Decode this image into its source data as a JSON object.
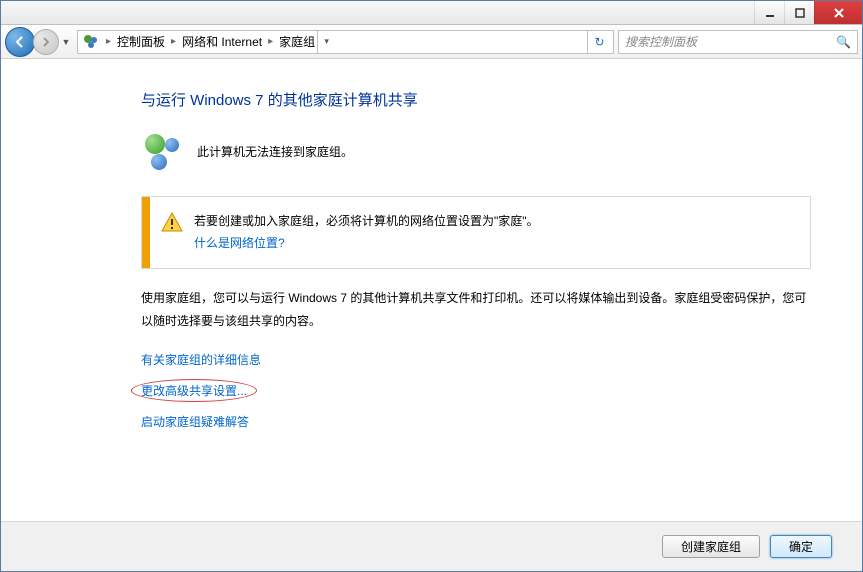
{
  "breadcrumb": {
    "items": [
      "控制面板",
      "网络和 Internet",
      "家庭组"
    ]
  },
  "search": {
    "placeholder": "搜索控制面板"
  },
  "main": {
    "heading": "与运行 Windows 7 的其他家庭计算机共享",
    "status": "此计算机无法连接到家庭组。",
    "warning": {
      "text": "若要创建或加入家庭组，必须将计算机的网络位置设置为\"家庭\"。",
      "link": "什么是网络位置?"
    },
    "description": "使用家庭组，您可以与运行 Windows 7 的其他计算机共享文件和打印机。还可以将媒体输出到设备。家庭组受密码保护，您可以随时选择要与该组共享的内容。",
    "links": {
      "details": "有关家庭组的详细信息",
      "advanced": "更改高级共享设置...",
      "troubleshoot": "启动家庭组疑难解答"
    }
  },
  "footer": {
    "create": "创建家庭组",
    "ok": "确定"
  }
}
